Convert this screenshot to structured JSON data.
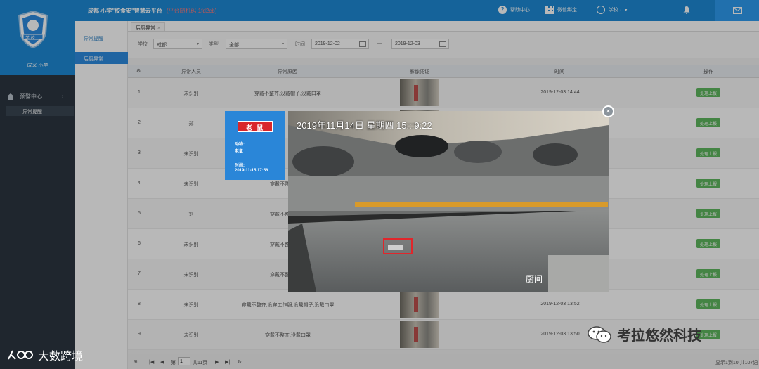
{
  "sidebar": {
    "logo_text": "学 校",
    "school_name": "成采        小学",
    "menu_group": "预警中心",
    "menu_sub": "异常提醒"
  },
  "submenu": {
    "items": [
      {
        "label": "异常提醒",
        "active": false
      },
      {
        "label": "后厨异常",
        "active": true
      }
    ]
  },
  "topbar": {
    "title": "成都            小学\"校食安\"智慧云平台",
    "platform_code": "(平台随机码 1fd2cb)",
    "help": "帮助中心",
    "scan": "微信绑定",
    "user": "学校 · ",
    "accent": "#1e8ad6"
  },
  "tabs": [
    {
      "label": "后厨异常"
    }
  ],
  "filters": {
    "school_label": "学校",
    "school_value": "成都",
    "type_label": "类型",
    "type_value": "全部",
    "time_label": "时间",
    "start_date": "2019-12-02",
    "separator": "—",
    "end_date": "2019-12-03"
  },
  "table": {
    "headers": [
      "异常人员",
      "异常原因",
      "影像凭证",
      "时间",
      "操作"
    ],
    "rows": [
      {
        "no": "1",
        "person": "未识别",
        "reason": "穿戴不整齐,没戴帽子,没戴口罩",
        "time": "2019-12-03 14:44",
        "action": "处理上报"
      },
      {
        "no": "2",
        "person": "郑",
        "reason": "",
        "time": "",
        "action": "处理上报"
      },
      {
        "no": "3",
        "person": "未识别",
        "reason": "",
        "time": "",
        "action": "处理上报"
      },
      {
        "no": "4",
        "person": "未识别",
        "reason": "穿戴不整齐,没穿",
        "time": "",
        "action": "处理上报"
      },
      {
        "no": "5",
        "person": "刘",
        "reason": "穿戴不整齐,没穿",
        "time": "",
        "action": "处理上报"
      },
      {
        "no": "6",
        "person": "未识别",
        "reason": "穿戴不整齐,没穿",
        "time": "",
        "action": "处理上报"
      },
      {
        "no": "7",
        "person": "未识别",
        "reason": "穿戴不整齐,没穿",
        "time": "",
        "action": "处理上报"
      },
      {
        "no": "8",
        "person": "未识别",
        "reason": "穿戴不整齐,没穿工作服,没戴帽子,没戴口罩",
        "time": "2019-12-03 13:52",
        "action": "处理上报"
      },
      {
        "no": "9",
        "person": "未识别",
        "reason": "穿戴不整齐,没戴口罩",
        "time": "2019-12-03 13:50",
        "action": "处理上报"
      }
    ]
  },
  "pager": {
    "page_prefix": "第",
    "page_value": "1",
    "page_suffix": "共11页",
    "summary": "显示1到10,共107记"
  },
  "modal": {
    "badge": "老 鼠",
    "animal_label": "动物:",
    "animal_value": "老鼠",
    "time_label": "时间:",
    "time_value": "2019-11-15 17:56",
    "camera_timestamp": "2019年11月14日  星期四  15:::9:22",
    "overlay_text": "厨间",
    "close": "×"
  },
  "watermarks": {
    "left": "大数跨境",
    "right": "考拉悠然科技"
  }
}
